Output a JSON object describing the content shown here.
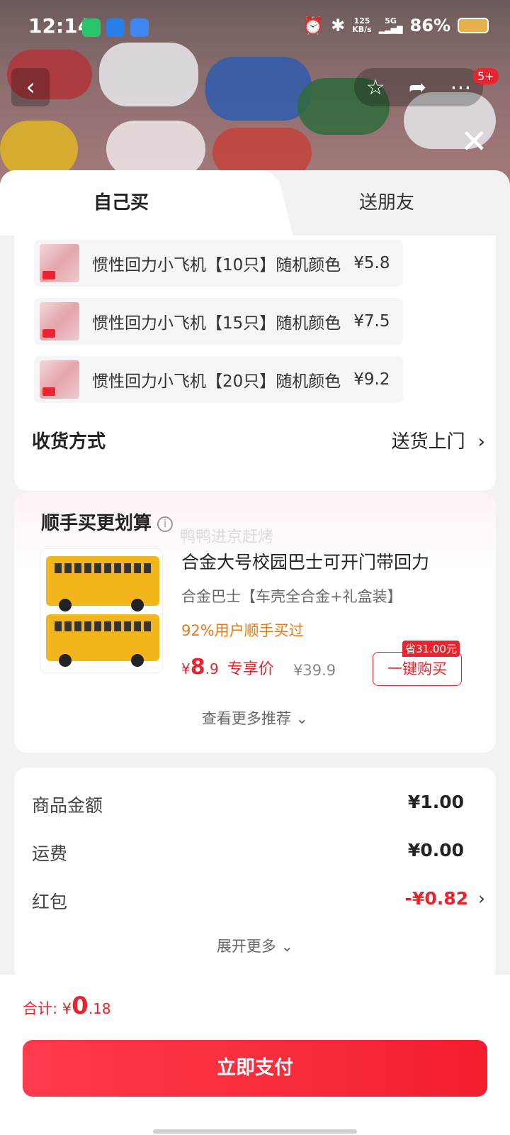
{
  "status_bar": {
    "time": "12:14",
    "net_speed": "125",
    "net_unit": "KB/s",
    "signal": "5G",
    "battery": "86%"
  },
  "nav": {
    "badge": "5+"
  },
  "tabs": {
    "self": "自己买",
    "friend": "送朋友"
  },
  "variants": [
    {
      "name": "惯性回力小飞机【10只】随机颜色",
      "price": "¥5.8"
    },
    {
      "name": "惯性回力小飞机【15只】随机颜色",
      "price": "¥7.5"
    },
    {
      "name": "惯性回力小飞机【20只】随机颜色",
      "price": "¥9.2"
    }
  ],
  "delivery": {
    "label": "收货方式",
    "value": "送货上门"
  },
  "recommend": {
    "title": "顺手买更划算",
    "watermark": "鸭鸭进京赶烤",
    "product_name": "合金大号校园巴士可开门带回力",
    "spec": "合金巴士【车壳全合金+礼盒装】",
    "pct": "92%用户顺手买过",
    "price_symbol": "¥",
    "price_int": "8",
    "price_dec": ".9",
    "price_tag": "专享价",
    "orig_price": "¥39.9",
    "save": "省31.00元",
    "buy_label": "一键购买",
    "more": "查看更多推荐"
  },
  "summary": {
    "rows": [
      {
        "label": "商品金额",
        "value": "¥1.00"
      },
      {
        "label": "运费",
        "value": "¥0.00"
      },
      {
        "label": "红包",
        "value": "-¥0.82"
      }
    ],
    "expand": "展开更多"
  },
  "footer": {
    "total_label": "合计:",
    "total_symbol": "¥",
    "total_int": "0",
    "total_dec": ".18",
    "pay": "立即支付"
  }
}
